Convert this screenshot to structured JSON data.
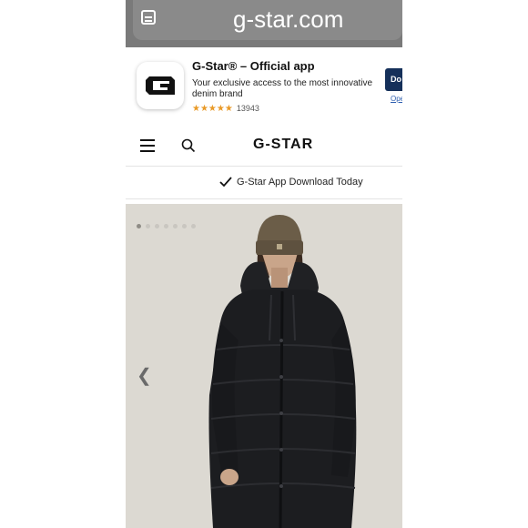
{
  "browser": {
    "url": "g-star.com"
  },
  "app_banner": {
    "title": "G-Star® – Official app",
    "description": "Your exclusive access to the most innovative denim brand",
    "stars": "★★★★★",
    "rating_value": 4.5,
    "rating_count": "13943",
    "download_label": "Do",
    "open_label": "Ope"
  },
  "header": {
    "logo": "G-STAR"
  },
  "promo": {
    "text": "G-Star App Download Today"
  },
  "gallery": {
    "slide_count": 7,
    "active_slide": 1,
    "colors": {
      "background": "#dcd9d2",
      "jacket": "#1c1d20",
      "beanie": "#6b5d48"
    }
  },
  "colors": {
    "banner_button": "#15305a",
    "star": "#e99a28"
  }
}
